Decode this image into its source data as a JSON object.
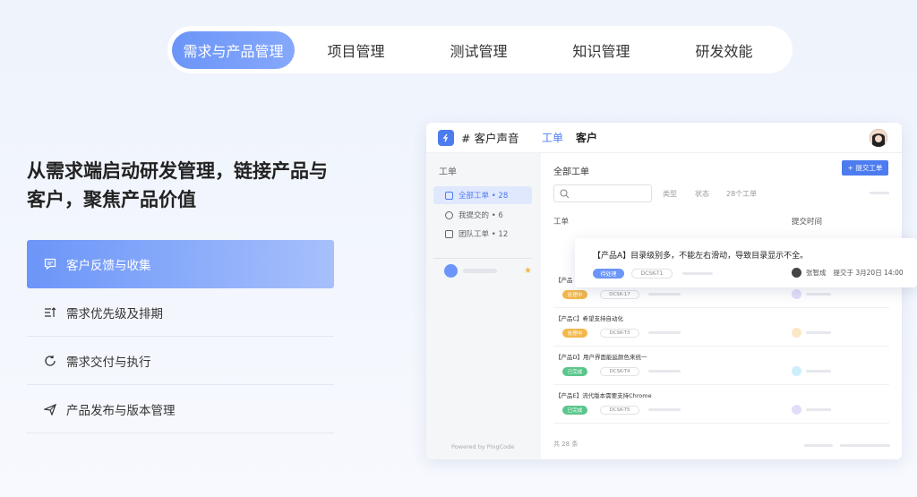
{
  "topnav": {
    "tabs": [
      {
        "label": "需求与产品管理",
        "active": true
      },
      {
        "label": "项目管理",
        "active": false
      },
      {
        "label": "测试管理",
        "active": false
      },
      {
        "label": "知识管理",
        "active": false
      },
      {
        "label": "研发效能",
        "active": false
      }
    ]
  },
  "hero": {
    "headline_line1": "从需求端启动研发管理，链接产品与",
    "headline_line2": "客户，聚焦产品价值"
  },
  "features": [
    {
      "label": "客户反馈与收集",
      "icon": "feedback-icon",
      "active": true
    },
    {
      "label": "需求优先级及排期",
      "icon": "priority-list-icon",
      "active": false
    },
    {
      "label": "需求交付与执行",
      "icon": "cycle-icon",
      "active": false
    },
    {
      "label": "产品发布与版本管理",
      "icon": "send-icon",
      "active": false
    }
  ],
  "app": {
    "title": "# 客户声音",
    "tabs": [
      "工单",
      "客户"
    ],
    "sidebar": {
      "title": "工单",
      "items": [
        {
          "label": "全部工单 • 28"
        },
        {
          "label": "我提交的 • 6"
        },
        {
          "label": "团队工单 • 12"
        }
      ],
      "powered": "Powered by PingCode"
    },
    "main": {
      "title": "全部工单",
      "submit_label": "+ 提交工单",
      "filters": [
        "类型",
        "状态",
        "28个工单"
      ],
      "col_ticket": "工单",
      "col_submitter": "提交时间",
      "rows": [
        {
          "title": "【产品",
          "status": "处理中",
          "code": "DCSK-17"
        },
        {
          "title": "【产品C】希望支持自动化",
          "status": "处理中",
          "code": "DCSK-T3"
        },
        {
          "title": "【产品D】用户界面能延颜色来统一",
          "status": "已完成",
          "code": "DCSK-T4"
        },
        {
          "title": "【产品E】流代版本需要支持Chrome",
          "status": "已完成",
          "code": "DCSK-T5"
        }
      ],
      "footer_count": "共 28 条"
    }
  },
  "popcard": {
    "title": "【产品A】目录级别多，不能左右滑动，导致目录显示不全。",
    "status": "待处理",
    "code": "DCSK-T1",
    "person": "张智成",
    "submitted": "提交于 3月20日 14:00"
  },
  "colors": {
    "accent": "#4d7cf0",
    "badge_processing": "#f2b84b",
    "badge_done": "#5bc68c"
  }
}
